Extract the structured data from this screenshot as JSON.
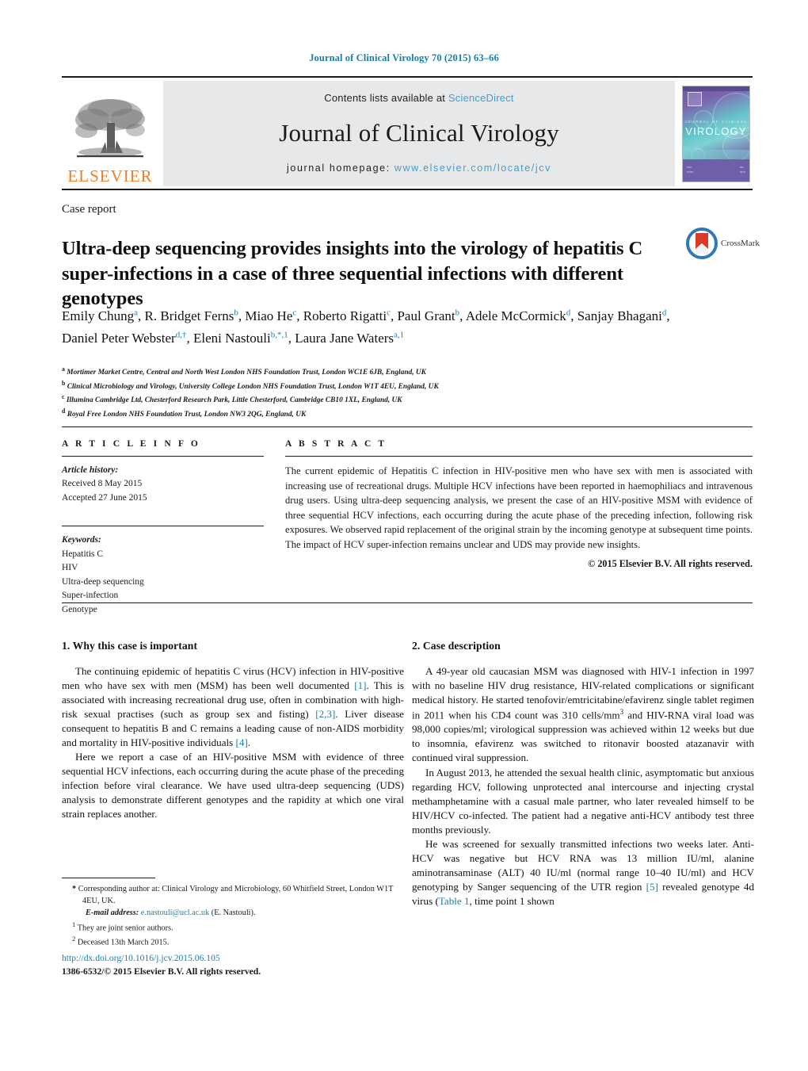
{
  "running_head": "Journal of Clinical Virology 70 (2015) 63–66",
  "masthead": {
    "publisher_name": "ELSEVIER",
    "contents_prefix": "Contents lists available at ",
    "contents_link": "ScienceDirect",
    "journal_name": "Journal of Clinical Virology",
    "homepage_prefix": "journal homepage: ",
    "homepage_url": "www.elsevier.com/locate/jcv",
    "cover": {
      "sub_title": "JOURNAL OF CLINICAL",
      "title": "VIROLOGY",
      "footer_left": "A Pan American Society\nfor Clinical Virology\nPublication",
      "footer_right": "Available online at\nScienceDirect\nwww.sciencedirect.com"
    }
  },
  "article": {
    "doc_type": "Case report",
    "title": "Ultra-deep sequencing provides insights into the virology of hepatitis C super-infections in a case of three sequential infections with different genotypes",
    "crossmark_label": "CrossMark",
    "authors_html": "Emily Chung<sup>a</sup>, R. Bridget Ferns<sup>b</sup>, Miao He<sup>c</sup>, Roberto Rigatti<sup>c</sup>, Paul Grant<sup>b</sup>, Adele McCormick<sup>d</sup>, Sanjay Bhagani<sup>d</sup>, Daniel Peter Webster<sup>d,†</sup>, Eleni Nastouli<sup>b,*,1</sup>, Laura Jane Waters<sup>a,1</sup>",
    "affiliations": [
      {
        "marker": "a",
        "text": "Mortimer Market Centre, Central and North West London NHS Foundation Trust, London WC1E 6JB, England, UK"
      },
      {
        "marker": "b",
        "text": "Clinical Microbiology and Virology, University College London NHS Foundation Trust, London W1T 4EU, England, UK"
      },
      {
        "marker": "c",
        "text": "Illumina Cambridge Ltd, Chesterford Research Park, Little Chesterford, Cambridge CB10 1XL, England, UK"
      },
      {
        "marker": "d",
        "text": "Royal Free London NHS Foundation Trust, London NW3 2QG, England, UK"
      }
    ]
  },
  "article_info": {
    "heading": "A R T I C L E  I N F O",
    "history_label": "Article history:",
    "history": [
      "Received 8 May 2015",
      "Accepted 27 June 2015"
    ],
    "keywords_label": "Keywords:",
    "keywords": [
      "Hepatitis C",
      "HIV",
      "Ultra-deep sequencing",
      "Super-infection",
      "Genotype"
    ]
  },
  "abstract": {
    "heading": "A B S T R A C T",
    "text": "The current epidemic of Hepatitis C infection in HIV-positive men who have sex with men is associated with increasing use of recreational drugs. Multiple HCV infections have been reported in haemophiliacs and intravenous drug users. Using ultra-deep sequencing analysis, we present the case of an HIV-positive MSM with evidence of three sequential HCV infections, each occurring during the acute phase of the preceding infection, following risk exposures. We observed rapid replacement of the original strain by the incoming genotype at subsequent time points. The impact of HCV super-infection remains unclear and UDS may provide new insights.",
    "copyright": "© 2015 Elsevier B.V. All rights reserved."
  },
  "sections": {
    "left": {
      "heading": "1.  Why this case is important",
      "paragraph1_html": "The continuing epidemic of hepatitis C virus (HCV) infection in HIV-positive men who have sex with men (MSM) has been well documented <span class=\"ref\">[1]</span>. This is associated with increasing recreational drug use, often in combination with high-risk sexual practises (such as group sex and fisting) <span class=\"ref\">[2,3]</span>. Liver disease consequent to hepatitis B and C remains a leading cause of non-AIDS morbidity and mortality in HIV-positive individuals <span class=\"ref\">[4]</span>.",
      "paragraph2_html": "Here we report a case of an HIV-positive MSM with evidence of three sequential HCV infections, each occurring during the acute phase of the preceding infection before viral clearance. We have used ultra-deep sequencing (UDS) analysis to demonstrate different genotypes and the rapidity at which one viral strain replaces another."
    },
    "right": {
      "heading": "2.  Case description",
      "paragraph1_html": "A 49-year old caucasian MSM was diagnosed with HIV-1 infection in 1997 with no baseline HIV drug resistance, HIV-related complications or significant medical history. He started tenofovir/emtricitabine/efavirenz single tablet regimen in 2011 when his CD4 count was 310 cells/mm<sup class=\"sm\">3</sup> and HIV-RNA viral load was 98,000 copies/ml; virological suppression was achieved within 12 weeks but due to insomnia, efavirenz was switched to ritonavir boosted atazanavir with continued viral suppression.",
      "paragraph2_html": "In August 2013, he attended the sexual health clinic, asymptomatic but anxious regarding HCV, following unprotected anal intercourse and injecting crystal methamphetamine with a casual male partner, who later revealed himself to be HIV/HCV co-infected. The patient had a negative anti-HCV antibody test three months previously.",
      "paragraph3_html": "He was screened for sexually transmitted infections two weeks later. Anti-HCV was negative but HCV RNA was 13 million IU/ml, alanine aminotransaminase (ALT) 40 IU/ml (normal range 10–40 IU/ml) and HCV genotyping by Sanger sequencing of the UTR region <span class=\"ref\">[5]</span> revealed genotype 4d virus (<span class=\"ref\">Table 1</span>, time point 1 shown"
    }
  },
  "footnotes": {
    "corresponding_html": "<b>*</b> Corresponding author at: Clinical Virology and Microbiology, 60 Whitfield Street, London W1T 4EU, UK.",
    "email_label": "E-mail address:",
    "email": "e.nastouli@ucl.ac.uk",
    "email_suffix": "(E. Nastouli).",
    "note1_marker": "1",
    "note1": "They are joint senior authors.",
    "note2_marker": "2",
    "note2": "Deceased 13th March 2015."
  },
  "doi": {
    "url": "http://dx.doi.org/10.1016/j.jcv.2015.06.105",
    "issn_line": "1386-6532/© 2015 Elsevier B.V. All rights reserved."
  },
  "colors": {
    "link_blue": "#1a7fa8",
    "sciencedirect_blue": "#3f9fd0",
    "elsevier_orange": "#F47C20",
    "band_gray": "#e7e8ea"
  }
}
